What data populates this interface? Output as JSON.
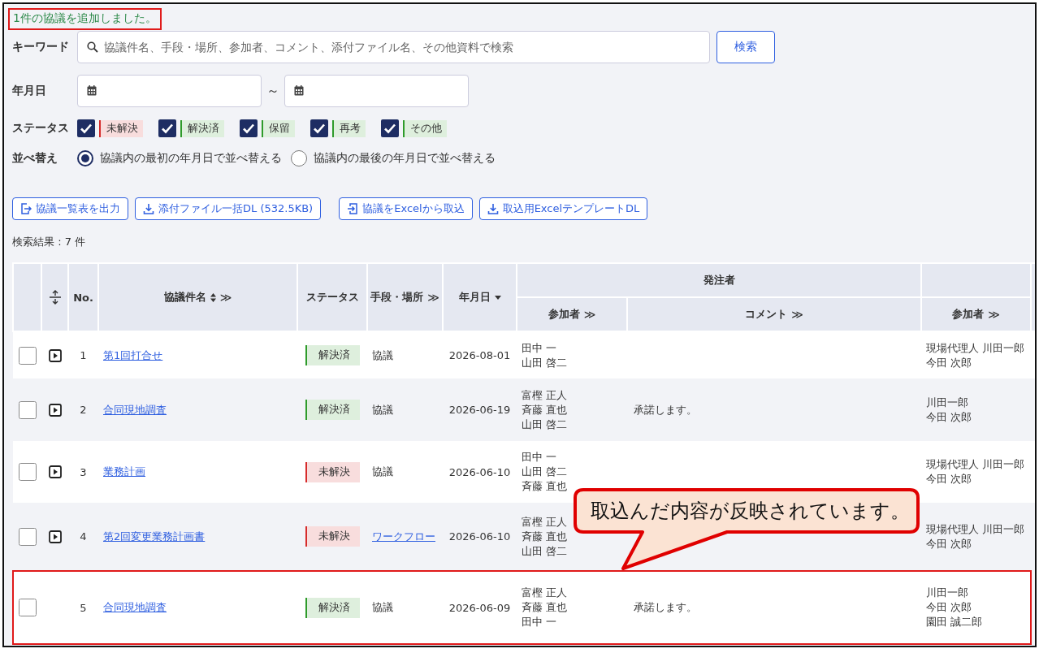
{
  "message": {
    "text": "1件の協議を追加しました。",
    "highlighted": true
  },
  "search": {
    "label": "キーワード",
    "placeholder": "協議件名、手段・場所、参加者、コメント、添付ファイル名、その他資料で検索",
    "button": "検索"
  },
  "date_range": {
    "label": "年月日",
    "separator": "～"
  },
  "status_filter": {
    "label": "ステータス",
    "options": [
      {
        "label": "未解決",
        "checked": true,
        "color": "#d62b2b"
      },
      {
        "label": "解決済",
        "checked": true,
        "color": "#2e9b2a"
      },
      {
        "label": "保留",
        "checked": true,
        "color": "#2e9b2a"
      },
      {
        "label": "再考",
        "checked": true,
        "color": "#2e9b2a"
      },
      {
        "label": "その他",
        "checked": true,
        "color": "#2e9b2a"
      }
    ]
  },
  "sort": {
    "label": "並べ替え",
    "options": [
      {
        "label": "協議内の最初の年月日で並べ替える",
        "selected": true
      },
      {
        "label": "協議内の最後の年月日で並べ替える",
        "selected": false
      }
    ]
  },
  "actions": [
    {
      "label": "協議一覧表を出力",
      "kind": "export"
    },
    {
      "label": "添付ファイル一括DL (532.5KB)",
      "kind": "download"
    },
    {
      "label": "協議をExcelから取込",
      "kind": "import"
    },
    {
      "label": "取込用ExcelテンプレートDL",
      "kind": "download"
    }
  ],
  "result_count": "検索結果 : 7 件",
  "table": {
    "columns": [
      {
        "label": "No."
      },
      {
        "label": "協議件名",
        "sortable": true,
        "toggle": "≫"
      },
      {
        "label": "ステータス"
      },
      {
        "label": "手段・場所",
        "toggle": "≫"
      },
      {
        "label": "年月日",
        "sorted": true
      }
    ],
    "groups": [
      {
        "label": "発注者",
        "columns": [
          {
            "label": "参加者",
            "toggle": "≫"
          },
          {
            "label": "コメント",
            "toggle": "≫"
          }
        ]
      },
      {
        "columns": [
          {
            "label": "参加者",
            "toggle": "≫"
          }
        ]
      }
    ],
    "rows": [
      {
        "checked": false,
        "expandable": true,
        "highlighted": false,
        "no": "1",
        "title": "第1回打合せ",
        "status": {
          "label": "解決済",
          "color": "#2e9b2a"
        },
        "method": {
          "text": "協議",
          "link": false
        },
        "date": "2026-08-01",
        "client_participants": [
          "田中 一",
          "山田 啓二"
        ],
        "contractor_participants": [
          "現場代理人 川田一郎",
          "今田 次郎"
        ]
      },
      {
        "checked": false,
        "expandable": true,
        "highlighted": false,
        "no": "2",
        "title": "合同現地調査",
        "status": {
          "label": "解決済",
          "color": "#2e9b2a"
        },
        "method": {
          "text": "協議",
          "link": false
        },
        "date": "2026-06-19",
        "client_participants": [
          "富樫 正人",
          "斉藤 直也",
          "山田 啓二"
        ],
        "comment": "承諾します。",
        "contractor_participants": [
          "川田一郎",
          "今田 次郎"
        ]
      },
      {
        "checked": false,
        "expandable": true,
        "highlighted": false,
        "no": "3",
        "title": "業務計画",
        "status": {
          "label": "未解決",
          "color": "#d62b2b"
        },
        "method": {
          "text": "協議",
          "link": false
        },
        "date": "2026-06-10",
        "client_participants": [
          "田中 一",
          "山田 啓二",
          "斉藤 直也"
        ],
        "contractor_participants": [
          "現場代理人 川田一郎",
          "今田 次郎"
        ]
      },
      {
        "checked": false,
        "expandable": true,
        "highlighted": false,
        "no": "4",
        "title": "第2回変更業務計画書",
        "status": {
          "label": "未解決",
          "color": "#d62b2b"
        },
        "method": {
          "text": "ワークフロー",
          "link": true
        },
        "date": "2026-06-10",
        "client_participants": [
          "富樫 正人",
          "斉藤 直也",
          "山田 啓二"
        ],
        "contractor_participants": [
          "現場代理人 川田一郎",
          "今田 次郎"
        ]
      },
      {
        "checked": false,
        "expandable": false,
        "highlighted": true,
        "no": "5",
        "title": "合同現地調査",
        "status": {
          "label": "解決済",
          "color": "#2e9b2a"
        },
        "method": {
          "text": "協議",
          "link": false
        },
        "date": "2026-06-09",
        "client_participants": [
          "富樫 正人",
          "斉藤 直也",
          "田中 一"
        ],
        "comment": "承諾します。",
        "contractor_participants": [
          "川田一郎",
          "今田 次郎",
          "園田 誠二郎"
        ]
      }
    ]
  },
  "callout": {
    "text": "取込んだ内容が反映されています。"
  }
}
